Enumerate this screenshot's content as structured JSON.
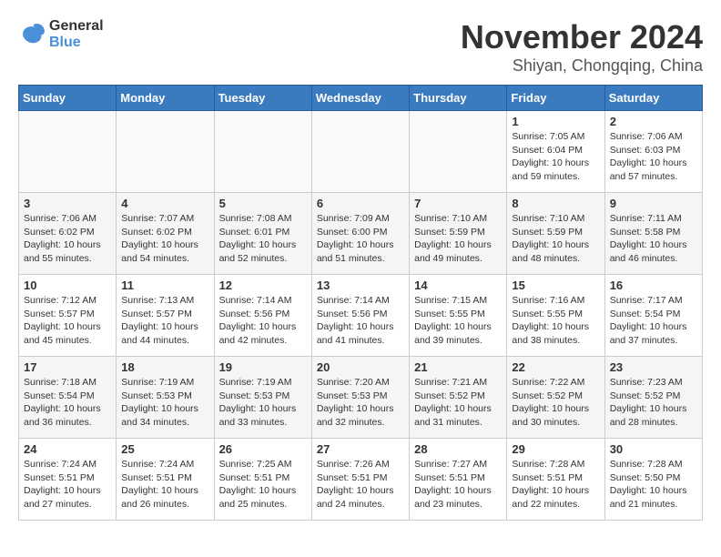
{
  "logo": {
    "line1": "General",
    "line2": "Blue"
  },
  "title": "November 2024",
  "location": "Shiyan, Chongqing, China",
  "weekdays": [
    "Sunday",
    "Monday",
    "Tuesday",
    "Wednesday",
    "Thursday",
    "Friday",
    "Saturday"
  ],
  "weeks": [
    [
      {
        "day": "",
        "info": ""
      },
      {
        "day": "",
        "info": ""
      },
      {
        "day": "",
        "info": ""
      },
      {
        "day": "",
        "info": ""
      },
      {
        "day": "",
        "info": ""
      },
      {
        "day": "1",
        "info": "Sunrise: 7:05 AM\nSunset: 6:04 PM\nDaylight: 10 hours and 59 minutes."
      },
      {
        "day": "2",
        "info": "Sunrise: 7:06 AM\nSunset: 6:03 PM\nDaylight: 10 hours and 57 minutes."
      }
    ],
    [
      {
        "day": "3",
        "info": "Sunrise: 7:06 AM\nSunset: 6:02 PM\nDaylight: 10 hours and 55 minutes."
      },
      {
        "day": "4",
        "info": "Sunrise: 7:07 AM\nSunset: 6:02 PM\nDaylight: 10 hours and 54 minutes."
      },
      {
        "day": "5",
        "info": "Sunrise: 7:08 AM\nSunset: 6:01 PM\nDaylight: 10 hours and 52 minutes."
      },
      {
        "day": "6",
        "info": "Sunrise: 7:09 AM\nSunset: 6:00 PM\nDaylight: 10 hours and 51 minutes."
      },
      {
        "day": "7",
        "info": "Sunrise: 7:10 AM\nSunset: 5:59 PM\nDaylight: 10 hours and 49 minutes."
      },
      {
        "day": "8",
        "info": "Sunrise: 7:10 AM\nSunset: 5:59 PM\nDaylight: 10 hours and 48 minutes."
      },
      {
        "day": "9",
        "info": "Sunrise: 7:11 AM\nSunset: 5:58 PM\nDaylight: 10 hours and 46 minutes."
      }
    ],
    [
      {
        "day": "10",
        "info": "Sunrise: 7:12 AM\nSunset: 5:57 PM\nDaylight: 10 hours and 45 minutes."
      },
      {
        "day": "11",
        "info": "Sunrise: 7:13 AM\nSunset: 5:57 PM\nDaylight: 10 hours and 44 minutes."
      },
      {
        "day": "12",
        "info": "Sunrise: 7:14 AM\nSunset: 5:56 PM\nDaylight: 10 hours and 42 minutes."
      },
      {
        "day": "13",
        "info": "Sunrise: 7:14 AM\nSunset: 5:56 PM\nDaylight: 10 hours and 41 minutes."
      },
      {
        "day": "14",
        "info": "Sunrise: 7:15 AM\nSunset: 5:55 PM\nDaylight: 10 hours and 39 minutes."
      },
      {
        "day": "15",
        "info": "Sunrise: 7:16 AM\nSunset: 5:55 PM\nDaylight: 10 hours and 38 minutes."
      },
      {
        "day": "16",
        "info": "Sunrise: 7:17 AM\nSunset: 5:54 PM\nDaylight: 10 hours and 37 minutes."
      }
    ],
    [
      {
        "day": "17",
        "info": "Sunrise: 7:18 AM\nSunset: 5:54 PM\nDaylight: 10 hours and 36 minutes."
      },
      {
        "day": "18",
        "info": "Sunrise: 7:19 AM\nSunset: 5:53 PM\nDaylight: 10 hours and 34 minutes."
      },
      {
        "day": "19",
        "info": "Sunrise: 7:19 AM\nSunset: 5:53 PM\nDaylight: 10 hours and 33 minutes."
      },
      {
        "day": "20",
        "info": "Sunrise: 7:20 AM\nSunset: 5:53 PM\nDaylight: 10 hours and 32 minutes."
      },
      {
        "day": "21",
        "info": "Sunrise: 7:21 AM\nSunset: 5:52 PM\nDaylight: 10 hours and 31 minutes."
      },
      {
        "day": "22",
        "info": "Sunrise: 7:22 AM\nSunset: 5:52 PM\nDaylight: 10 hours and 30 minutes."
      },
      {
        "day": "23",
        "info": "Sunrise: 7:23 AM\nSunset: 5:52 PM\nDaylight: 10 hours and 28 minutes."
      }
    ],
    [
      {
        "day": "24",
        "info": "Sunrise: 7:24 AM\nSunset: 5:51 PM\nDaylight: 10 hours and 27 minutes."
      },
      {
        "day": "25",
        "info": "Sunrise: 7:24 AM\nSunset: 5:51 PM\nDaylight: 10 hours and 26 minutes."
      },
      {
        "day": "26",
        "info": "Sunrise: 7:25 AM\nSunset: 5:51 PM\nDaylight: 10 hours and 25 minutes."
      },
      {
        "day": "27",
        "info": "Sunrise: 7:26 AM\nSunset: 5:51 PM\nDaylight: 10 hours and 24 minutes."
      },
      {
        "day": "28",
        "info": "Sunrise: 7:27 AM\nSunset: 5:51 PM\nDaylight: 10 hours and 23 minutes."
      },
      {
        "day": "29",
        "info": "Sunrise: 7:28 AM\nSunset: 5:51 PM\nDaylight: 10 hours and 22 minutes."
      },
      {
        "day": "30",
        "info": "Sunrise: 7:28 AM\nSunset: 5:50 PM\nDaylight: 10 hours and 21 minutes."
      }
    ]
  ]
}
